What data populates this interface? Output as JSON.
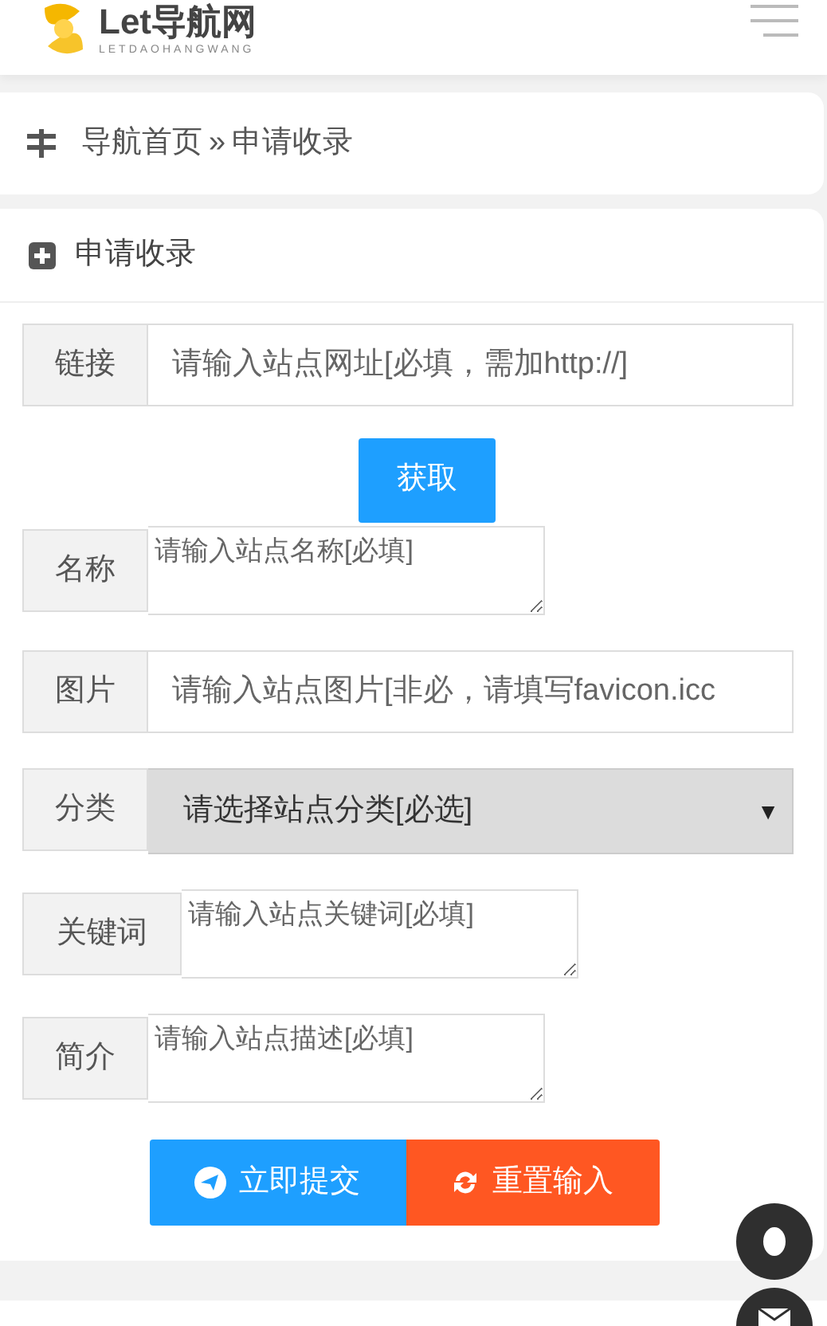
{
  "header": {
    "logo_text": "Let导航网",
    "logo_subtext": "LETDAOHANGWANG"
  },
  "breadcrumb": {
    "home": "导航首页",
    "separator": "»",
    "current": "申请收录"
  },
  "form": {
    "title": "申请收录",
    "fields": [
      {
        "kind": "input",
        "label": "链接",
        "placeholder": "请输入站点网址[必填，需加http://]"
      },
      {
        "kind": "button",
        "label": "获取"
      },
      {
        "kind": "textarea",
        "label": "名称",
        "placeholder": "请输入站点名称[必填]"
      },
      {
        "kind": "input",
        "label": "图片",
        "placeholder": "请输入站点图片[非必，请填写favicon.icc"
      },
      {
        "kind": "select",
        "label": "分类",
        "value": "请选择站点分类[必选]",
        "arrow": "▼"
      },
      {
        "kind": "textarea",
        "label": "关键词",
        "placeholder": "请输入站点关键词[必填]"
      },
      {
        "kind": "textarea",
        "label": "简介",
        "placeholder": "请输入站点描述[必填]"
      }
    ],
    "submit": "立即提交",
    "reset": "重置输入"
  }
}
